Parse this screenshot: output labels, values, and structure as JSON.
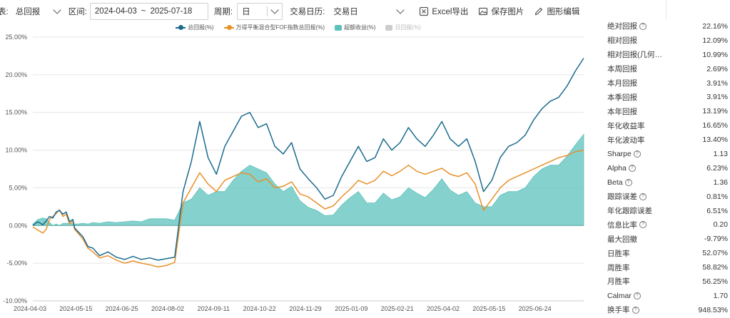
{
  "toolbar": {
    "cut_label": "表:",
    "mode_value": "总回报",
    "interval_label": "区间:",
    "date_start": "2024-04-03",
    "date_sep": "~",
    "date_end": "2025-07-18",
    "period_label": "周期:",
    "period_value": "日",
    "calendar_label": "交易日历:",
    "calendar_value": "交易日",
    "excel_label": "Excel导出",
    "save_label": "保存图片",
    "settings_label": "图形编辑"
  },
  "legend": [
    {
      "label": "总回报(%)",
      "color": "#1a6b8c",
      "kind": "line"
    },
    {
      "label": "万得平衡混合型FOF指数总回报(%)",
      "color": "#e8902a",
      "kind": "line"
    },
    {
      "label": "超额收益(%)",
      "color": "#5cc1bc",
      "kind": "area"
    },
    {
      "label": "日回报(%)",
      "color": "#cccccc",
      "kind": "area"
    }
  ],
  "metrics": [
    {
      "label": "绝对回报",
      "value": "22.16%",
      "help": true
    },
    {
      "label": "相对回报",
      "value": "12.09%",
      "help": false
    },
    {
      "label": "相对回报(几何…",
      "value": "10.99%",
      "help": false
    },
    {
      "label": "本周回报",
      "value": "2.69%",
      "help": false
    },
    {
      "label": "本月回报",
      "value": "3.91%",
      "help": false
    },
    {
      "label": "本季回报",
      "value": "3.91%",
      "help": false
    },
    {
      "label": "本年回报",
      "value": "13.19%",
      "help": false
    },
    {
      "label": "年化收益率",
      "value": "16.65%",
      "help": false
    },
    {
      "label": "年化波动率",
      "value": "13.40%",
      "help": false
    },
    {
      "label": "Sharpe",
      "value": "1.13",
      "help": true
    },
    {
      "label": "Alpha",
      "value": "6.23%",
      "help": true
    },
    {
      "label": "Beta",
      "value": "1.36",
      "help": true
    },
    {
      "label": "跟踪误差",
      "value": "0.81%",
      "help": true
    },
    {
      "label": "年化跟踪误差",
      "value": "6.51%",
      "help": false
    },
    {
      "label": "信息比率",
      "value": "0.20",
      "help": true
    },
    {
      "label": "最大回撤",
      "value": "-9.79%",
      "help": false
    },
    {
      "label": "日胜率",
      "value": "52.07%",
      "help": false
    },
    {
      "label": "周胜率",
      "value": "58.82%",
      "help": false
    },
    {
      "label": "月胜率",
      "value": "56.25%",
      "help": false
    },
    {
      "label": "Calmar",
      "value": "1.70",
      "help": true
    },
    {
      "label": "换手率",
      "value": "948.53%",
      "help": true
    }
  ],
  "chart_data": {
    "type": "line",
    "ylim": [
      -10,
      25
    ],
    "yticks": [
      25,
      20,
      15,
      10,
      5,
      0,
      -5,
      -10
    ],
    "ytick_labels": [
      "25.00%",
      "20.00%",
      "15.00%",
      "10.00%",
      "5.00%",
      "0.00%",
      "-5.00%",
      "-10.00%"
    ],
    "x_tick_labels": [
      "2024-04-03",
      "2024-05-15",
      "2024-06-25",
      "2024-08-02",
      "2024-09-11",
      "2024-10-22",
      "2024-11-29",
      "2025-01-09",
      "2025-02-21",
      "2025-04-02",
      "2025-05-15",
      "2025-06-24"
    ],
    "series": [
      {
        "name": "总回报(%)",
        "color": "#1a6b8c",
        "x": [
          0,
          3,
          6,
          8,
          10,
          12,
          14,
          16,
          18,
          20,
          22,
          24,
          25,
          27,
          30,
          33,
          36,
          40,
          45,
          50,
          55,
          60,
          65,
          70,
          75,
          80,
          85,
          90,
          95,
          100,
          105,
          110,
          115,
          120,
          125,
          130,
          135,
          140,
          145,
          150,
          155,
          160,
          165,
          170,
          175,
          180,
          185,
          190,
          195,
          200,
          205,
          210,
          215,
          220,
          225,
          230,
          235,
          240,
          245,
          250,
          255,
          260,
          265,
          270,
          275,
          280,
          285,
          290,
          295,
          300,
          305,
          310,
          315,
          320,
          325,
          330
        ],
        "values": [
          0.0,
          0.5,
          0.1,
          0.6,
          1.2,
          1.0,
          1.8,
          2.0,
          1.5,
          1.8,
          0.5,
          0.8,
          -0.3,
          -0.8,
          -1.5,
          -2.8,
          -3.0,
          -4.0,
          -3.5,
          -4.2,
          -4.5,
          -4.1,
          -4.5,
          -4.3,
          -4.6,
          -4.4,
          -4.2,
          4.5,
          8.5,
          13.8,
          9.0,
          6.8,
          10.5,
          12.5,
          14.5,
          15.0,
          13.0,
          13.5,
          10.5,
          9.5,
          11.0,
          7.5,
          6.2,
          5.0,
          3.5,
          4.0,
          6.5,
          8.5,
          10.5,
          8.5,
          9.0,
          11.5,
          10.0,
          11.0,
          13.0,
          11.5,
          10.5,
          12.0,
          13.8,
          11.5,
          10.5,
          11.5,
          8.5,
          4.5,
          6.0,
          9.0,
          10.5,
          11.0,
          12.0,
          14.0,
          15.5,
          16.5,
          17.0,
          18.5,
          20.5,
          22.2
        ]
      },
      {
        "name": "万得平衡混合型FOF指数总回报(%)",
        "color": "#e8902a",
        "x": [
          0,
          3,
          6,
          8,
          10,
          12,
          14,
          16,
          18,
          20,
          22,
          24,
          25,
          27,
          30,
          33,
          36,
          40,
          45,
          50,
          55,
          60,
          65,
          70,
          75,
          80,
          85,
          90,
          95,
          100,
          105,
          110,
          115,
          120,
          125,
          130,
          135,
          140,
          145,
          150,
          155,
          160,
          165,
          170,
          175,
          180,
          185,
          190,
          195,
          200,
          205,
          210,
          215,
          220,
          225,
          230,
          235,
          240,
          245,
          250,
          255,
          260,
          265,
          270,
          275,
          280,
          285,
          290,
          295,
          300,
          305,
          310,
          315,
          320,
          325,
          330
        ],
        "values": [
          -0.2,
          -0.6,
          -1.0,
          -0.5,
          0.8,
          1.2,
          1.6,
          2.1,
          1.2,
          1.5,
          0.2,
          0.6,
          -0.5,
          -1.0,
          -1.8,
          -3.0,
          -3.5,
          -4.3,
          -4.0,
          -4.6,
          -5.0,
          -4.7,
          -5.0,
          -5.2,
          -5.5,
          -5.3,
          -4.9,
          3.0,
          5.0,
          7.0,
          5.5,
          4.5,
          6.0,
          6.5,
          7.0,
          6.8,
          5.8,
          6.2,
          5.0,
          5.2,
          5.8,
          4.2,
          3.8,
          3.0,
          2.2,
          2.6,
          3.8,
          4.8,
          6.0,
          5.5,
          6.0,
          7.2,
          6.6,
          7.2,
          8.0,
          7.2,
          6.8,
          7.2,
          7.6,
          6.8,
          6.5,
          7.0,
          5.5,
          2.0,
          3.5,
          5.0,
          6.0,
          6.5,
          7.0,
          7.5,
          8.0,
          8.5,
          9.0,
          9.3,
          9.8,
          10.0
        ]
      },
      {
        "name": "超额收益(%)",
        "color": "#5cc1bc",
        "x": [
          0,
          3,
          6,
          8,
          10,
          12,
          14,
          16,
          18,
          20,
          22,
          24,
          25,
          27,
          30,
          33,
          36,
          40,
          45,
          50,
          55,
          60,
          65,
          70,
          75,
          80,
          85,
          90,
          95,
          100,
          105,
          110,
          115,
          120,
          125,
          130,
          135,
          140,
          145,
          150,
          155,
          160,
          165,
          170,
          175,
          180,
          185,
          190,
          195,
          200,
          205,
          210,
          215,
          220,
          225,
          230,
          235,
          240,
          245,
          250,
          255,
          260,
          265,
          270,
          275,
          280,
          285,
          290,
          295,
          300,
          305,
          310,
          315,
          320,
          325,
          330
        ],
        "values": [
          0.2,
          0.8,
          1.0,
          0.9,
          0.4,
          0.0,
          0.2,
          0.0,
          0.3,
          0.3,
          0.3,
          0.2,
          0.2,
          0.2,
          0.3,
          0.2,
          0.4,
          0.3,
          0.5,
          0.4,
          0.5,
          0.6,
          0.5,
          0.9,
          0.9,
          0.9,
          0.7,
          3.0,
          3.5,
          5.0,
          4.0,
          4.5,
          4.5,
          6.0,
          7.2,
          8.0,
          7.5,
          7.0,
          5.5,
          4.5,
          5.2,
          3.3,
          2.4,
          2.0,
          1.3,
          1.4,
          2.7,
          3.7,
          4.5,
          3.0,
          3.0,
          4.3,
          3.4,
          3.8,
          5.0,
          4.3,
          3.7,
          4.8,
          6.2,
          4.7,
          4.0,
          4.5,
          3.0,
          2.5,
          2.5,
          4.0,
          4.5,
          4.5,
          5.0,
          6.5,
          7.5,
          8.0,
          8.0,
          9.2,
          10.7,
          12.1
        ]
      }
    ]
  }
}
